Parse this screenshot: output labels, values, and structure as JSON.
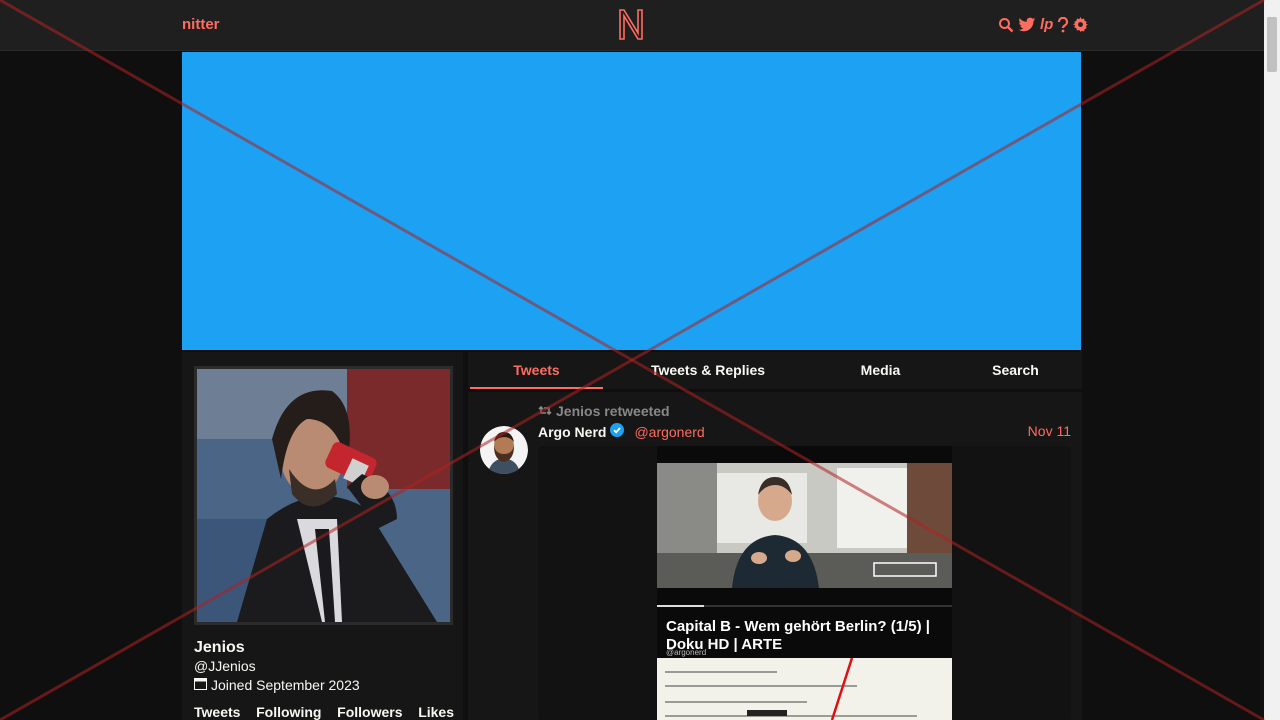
{
  "app": {
    "brand": "nitter"
  },
  "nav": {
    "icons": [
      "search-icon",
      "twitter-bird-icon",
      "lp-icon",
      "help-icon",
      "settings-gear-icon"
    ],
    "lp_text": "lp"
  },
  "colors": {
    "accent": "#ff6c60",
    "banner": "#1da1f2",
    "background": "#0f0f0f",
    "panel": "#161616"
  },
  "profile": {
    "fullname": "Jenios",
    "username": "@JJenios",
    "joined": "Joined September 2023",
    "stats": [
      "Tweets",
      "Following",
      "Followers",
      "Likes"
    ]
  },
  "tabs": [
    "Tweets",
    "Tweets & Replies",
    "Media",
    "Search"
  ],
  "active_tab": "Tweets",
  "tweet": {
    "retweet_label": "Jenios retweeted",
    "fullname": "Argo Nerd",
    "username": "@argonerd",
    "date": "Nov 11",
    "verified": true,
    "video": {
      "title": "Capital B - Wem gehört Berlin? (1/5) | Doku HD | ARTE",
      "handle": "@argonerd",
      "progress": 0.16
    }
  }
}
